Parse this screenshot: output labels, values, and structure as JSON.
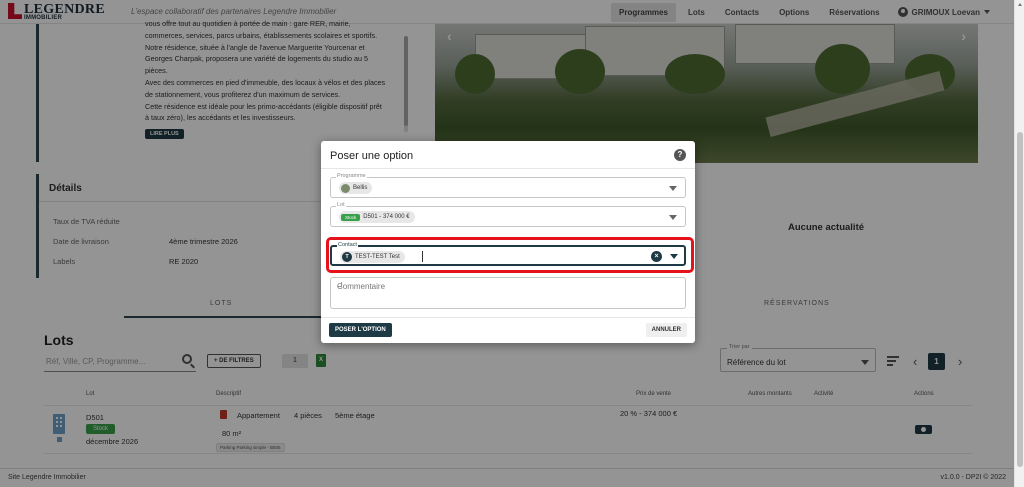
{
  "header": {
    "brand": "LEGENDRE",
    "brand_sub": "IMMOBILIER",
    "tagline": "L'espace collaboratif des partenaires Legendre Immobilier",
    "nav": [
      "Programmes",
      "Lots",
      "Contacts",
      "Options",
      "Réservations"
    ],
    "active_nav": "Programmes",
    "user": "GRIMOUX Loevan"
  },
  "description": {
    "lines": [
      "vous offre tout au quotidien à portée de main : gare RER, mairie,",
      "commerces, services, parcs urbains, établissements scolaires et sportifs.",
      "Notre résidence, située à l'angle de l'avenue Marguerite Yourcenar et",
      "Georges Charpak, proposera une variété de logements du studio au 5",
      "pièces.",
      "Avec des commerces en pied d'immeuble, des locaux à vélos et des places",
      "de stationnement, vous profiterez d'un maximum de services.",
      "Cette résidence est idéale pour les primo-accédants (éligible dispositif prêt",
      "à taux zéro), les accédants et les investisseurs."
    ],
    "read_more": "LIRE PLUS"
  },
  "details": {
    "title": "Détails",
    "rows": [
      {
        "label": "Taux de TVA réduite",
        "value": ""
      },
      {
        "label": "Date de livraison",
        "value": "4ème trimestre 2026"
      },
      {
        "label": "Labels",
        "value": "RE 2020"
      }
    ]
  },
  "news": {
    "empty": "Aucune actualité"
  },
  "tabs": {
    "lots": "LOTS",
    "reservations": "RÉSERVATIONS"
  },
  "lots": {
    "title": "Lots",
    "search_placeholder": "Réf, Ville, CP, Programme...",
    "filter_button": "+ DE FILTRES",
    "filter_count": "1",
    "export_icon": "X",
    "sort_label": "Trier par",
    "sort_value": "Référence du lot",
    "page_prev": "‹",
    "page": "1",
    "page_next": "›",
    "columns": [
      "Lot",
      "Descriptif",
      "Prix de vente",
      "Autres montants",
      "Activité",
      "Actions"
    ],
    "row": {
      "ref": "D501",
      "status": "Stock",
      "delivery": "décembre 2026",
      "type": "Appartement",
      "rooms": "4 pièces",
      "floor": "5ème étage",
      "area": "80 m²",
      "parking": "Parking Parking simple - B506",
      "price": "20 % - 374 000 €"
    }
  },
  "footer": {
    "left": "Site Legendre Immobilier",
    "right": "v1.0.0 - DP2I © 2022"
  },
  "modal": {
    "title": "Poser une option",
    "help": "?",
    "programme_label": "Programme",
    "programme_value": "Bellis",
    "lot_label": "Lot",
    "lot_status": "Stock",
    "lot_value": "D501 - 374 000 €",
    "contact_label": "Contact",
    "contact_initial": "T",
    "contact_value": "TEST-TEST Test",
    "clear": "×",
    "comment_placeholder": "Commentaire",
    "submit": "POSER L'OPTION",
    "cancel": "ANNULER"
  },
  "colors": {
    "accent": "#1e3a44",
    "stock": "#37a04b",
    "highlight": "#e5121b",
    "brand": "#c8102e"
  }
}
